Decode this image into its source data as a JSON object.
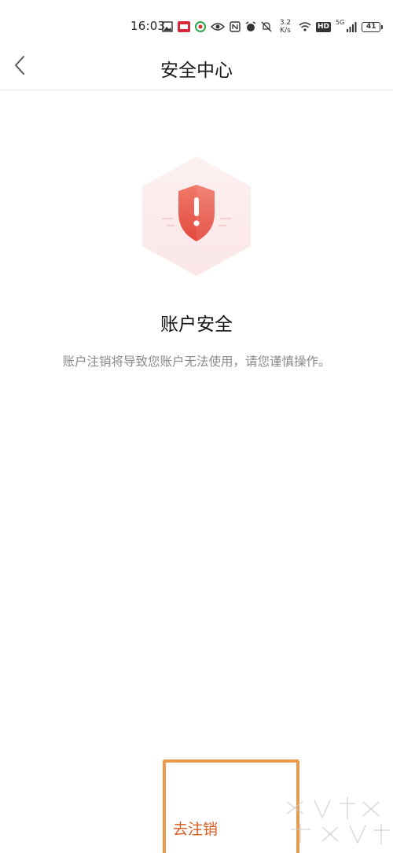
{
  "status_bar": {
    "time": "16:03",
    "net_speed_value": "3.2",
    "net_speed_unit": "K/s",
    "battery": "41",
    "hd_label": "HD",
    "signal_label": "5G"
  },
  "header": {
    "title": "安全中心"
  },
  "main": {
    "section_title": "账户安全",
    "description": "账户注销将导致您账户无法使用，请您谨慎操作。"
  },
  "footer": {
    "deregister_label": "去注销"
  },
  "colors": {
    "accent": "#d85a1f",
    "shield": "#e9604e",
    "highlight": "#e99a4a"
  }
}
